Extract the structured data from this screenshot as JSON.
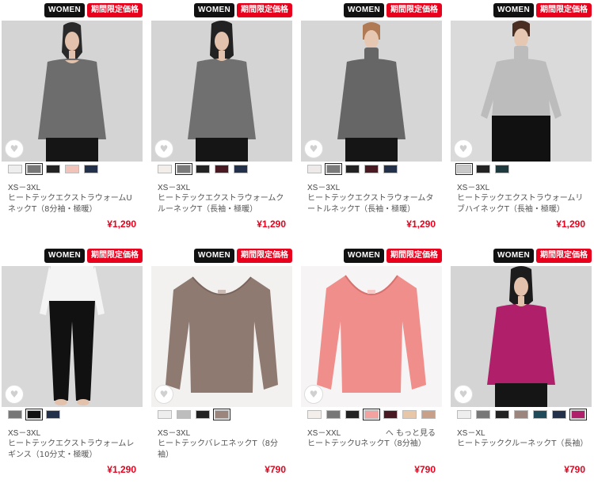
{
  "products": [
    {
      "badge_women": "WOMEN",
      "badge_limited": "期間限定価格",
      "size": "XS－3XL",
      "name": "ヒートテックエクストラウォームUネックT（8分袖・極暖）",
      "price": "¥1,290",
      "colors": [
        "#eeeeee",
        "#777777",
        "#222222",
        "#f2c3b8",
        "#23304a"
      ],
      "selected": 1,
      "fav_icon": "heart-icon"
    },
    {
      "badge_women": "WOMEN",
      "badge_limited": "期間限定価格",
      "size": "XS－3XL",
      "name": "ヒートテックエクストラウォームクルーネックT（長袖・極暖）",
      "price": "¥1,290",
      "colors": [
        "#f4eeea",
        "#7b7b7b",
        "#222222",
        "#4a1a22",
        "#23304a"
      ],
      "selected": 1,
      "fav_icon": "heart-icon"
    },
    {
      "badge_women": "WOMEN",
      "badge_limited": "期間限定価格",
      "size": "XS－3XL",
      "name": "ヒートテックエクストラウォームタートルネックT（長袖・極暖）",
      "price": "¥1,290",
      "colors": [
        "#eeeaea",
        "#7b7b7b",
        "#222222",
        "#4a1a22",
        "#23304a"
      ],
      "selected": 1,
      "fav_icon": "heart-icon"
    },
    {
      "badge_women": "WOMEN",
      "badge_limited": "期間限定価格",
      "size": "XS－3XL",
      "name": "ヒートテックエクストラウォームリブハイネックT（長袖・極暖）",
      "price": "¥1,290",
      "colors": [
        "#c8c8c8",
        "#222222",
        "#1e3a3e"
      ],
      "selected": 0,
      "fav_icon": "heart-icon"
    },
    {
      "badge_women": "WOMEN",
      "badge_limited": "期間限定価格",
      "size": "XS－3XL",
      "name": "ヒートテックエクストラウォームレギンス（10分丈・極暖）",
      "price": "¥1,290",
      "colors": [
        "#777777",
        "#111111",
        "#23304a"
      ],
      "selected": 1,
      "fav_icon": "heart-icon"
    },
    {
      "badge_women": "WOMEN",
      "badge_limited": "期間限定価格",
      "size": "XS－3XL",
      "name": "ヒートテックバレエネックT（8分袖）",
      "price": "¥790",
      "colors": [
        "#eeeeee",
        "#bdbdbd",
        "#222222",
        "#9b857c"
      ],
      "selected": 3,
      "fav_icon": "heart-icon"
    },
    {
      "badge_women": "WOMEN",
      "badge_limited": "期間限定価格",
      "size": "XS－XXL",
      "name": "ヒートテックUネックT（8分袖）",
      "price": "¥790",
      "more": "へ もっと見る",
      "colors": [
        "#f4eeea",
        "#777777",
        "#222222",
        "#f4a2a0",
        "#4a1a22",
        "#e8c6a8",
        "#c8a08a"
      ],
      "selected": 3,
      "fav_icon": "heart-icon"
    },
    {
      "badge_women": "WOMEN",
      "badge_limited": "期間限定価格",
      "size": "XS－XL",
      "name": "ヒートテッククルーネックT（長袖）",
      "price": "¥790",
      "colors": [
        "#eeeeee",
        "#777777",
        "#222222",
        "#9b857c",
        "#1e4a5a",
        "#23304a",
        "#b0206a"
      ],
      "selected": 6,
      "fav_icon": "heart-icon"
    }
  ]
}
